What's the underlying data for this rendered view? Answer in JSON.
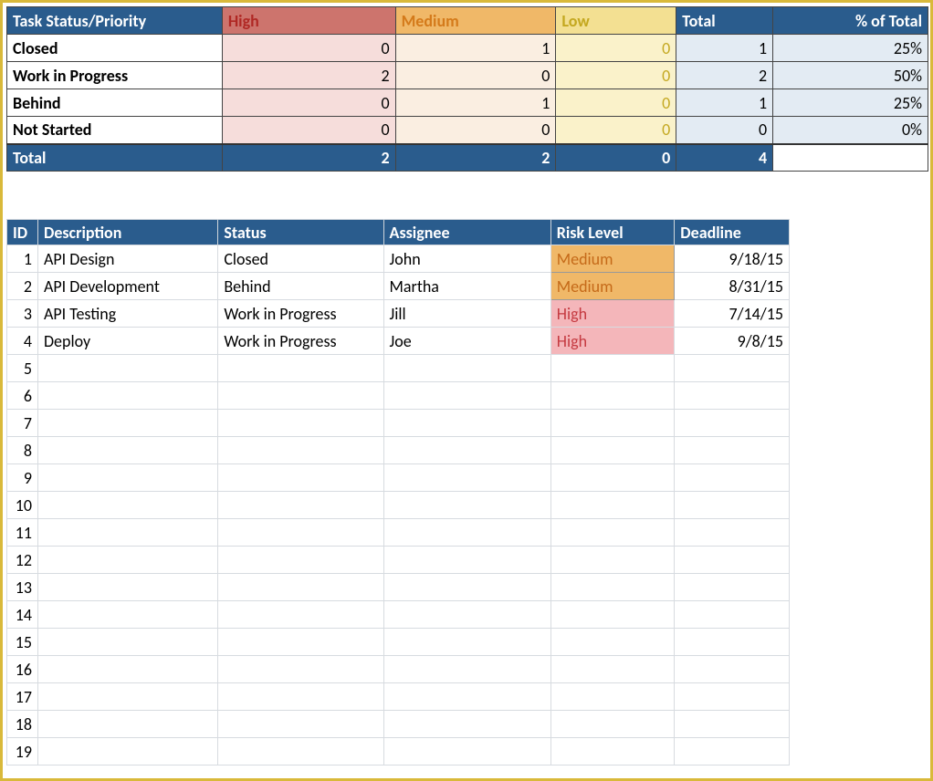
{
  "summary": {
    "header": {
      "status_priority": "Task Status/Priority",
      "high": "High",
      "medium": "Medium",
      "low": "Low",
      "total": "Total",
      "pct": "% of Total"
    },
    "rows": [
      {
        "label": "Closed",
        "high": "0",
        "medium": "1",
        "low": "0",
        "total": "1",
        "pct": "25%"
      },
      {
        "label": "Work in Progress",
        "high": "2",
        "medium": "0",
        "low": "0",
        "total": "2",
        "pct": "50%"
      },
      {
        "label": "Behind",
        "high": "0",
        "medium": "1",
        "low": "0",
        "total": "1",
        "pct": "25%"
      },
      {
        "label": "Not Started",
        "high": "0",
        "medium": "0",
        "low": "0",
        "total": "0",
        "pct": "0%"
      }
    ],
    "totals": {
      "label": "Total",
      "high": "2",
      "medium": "2",
      "low": "0",
      "total": "4",
      "pct": ""
    }
  },
  "tasks": {
    "header": {
      "id": "ID",
      "description": "Description",
      "status": "Status",
      "assignee": "Assignee",
      "risk": "Risk Level",
      "deadline": "Deadline"
    },
    "rows": [
      {
        "id": "1",
        "description": "API Design",
        "status": "Closed",
        "assignee": "John",
        "risk": "Medium",
        "risk_class": "risk-medium",
        "deadline": "9/18/15"
      },
      {
        "id": "2",
        "description": "API Development",
        "status": "Behind",
        "assignee": "Martha",
        "risk": "Medium",
        "risk_class": "risk-medium",
        "deadline": "8/31/15"
      },
      {
        "id": "3",
        "description": "API Testing",
        "status": "Work in Progress",
        "assignee": "Jill",
        "risk": "High",
        "risk_class": "risk-high",
        "deadline": "7/14/15"
      },
      {
        "id": "4",
        "description": "Deploy",
        "status": "Work in Progress",
        "assignee": "Joe",
        "risk": "High",
        "risk_class": "risk-high",
        "deadline": "9/8/15"
      }
    ],
    "empty_rows": [
      "5",
      "6",
      "7",
      "8",
      "9",
      "10",
      "11",
      "12",
      "13",
      "14",
      "15",
      "16",
      "17",
      "18",
      "19"
    ]
  }
}
